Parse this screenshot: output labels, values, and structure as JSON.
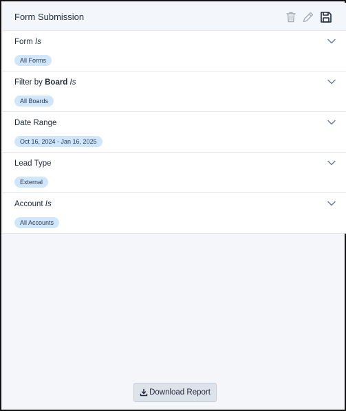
{
  "header": {
    "title": "Form Submission",
    "icons": [
      "trash-icon",
      "pencil-icon",
      "save-icon"
    ]
  },
  "filters": [
    {
      "label": "Form",
      "label_qualifier": "Is",
      "chip": "All Forms"
    },
    {
      "label": "Filter by",
      "label_strong": "Board",
      "label_qualifier": "Is",
      "chip": "All Boards"
    },
    {
      "label": "Date Range",
      "chip": "Oct 16, 2024 - Jan 16, 2025"
    },
    {
      "label": "Lead Type",
      "chip": "External"
    },
    {
      "label": "Account",
      "label_qualifier": "Is",
      "chip": "All Accounts"
    }
  ],
  "footer": {
    "download_label": "Download Report"
  },
  "colors": {
    "chip_bg": "#cfe6fb",
    "header_bg": "#f3f6fb",
    "button_bg": "#dde3ea"
  }
}
